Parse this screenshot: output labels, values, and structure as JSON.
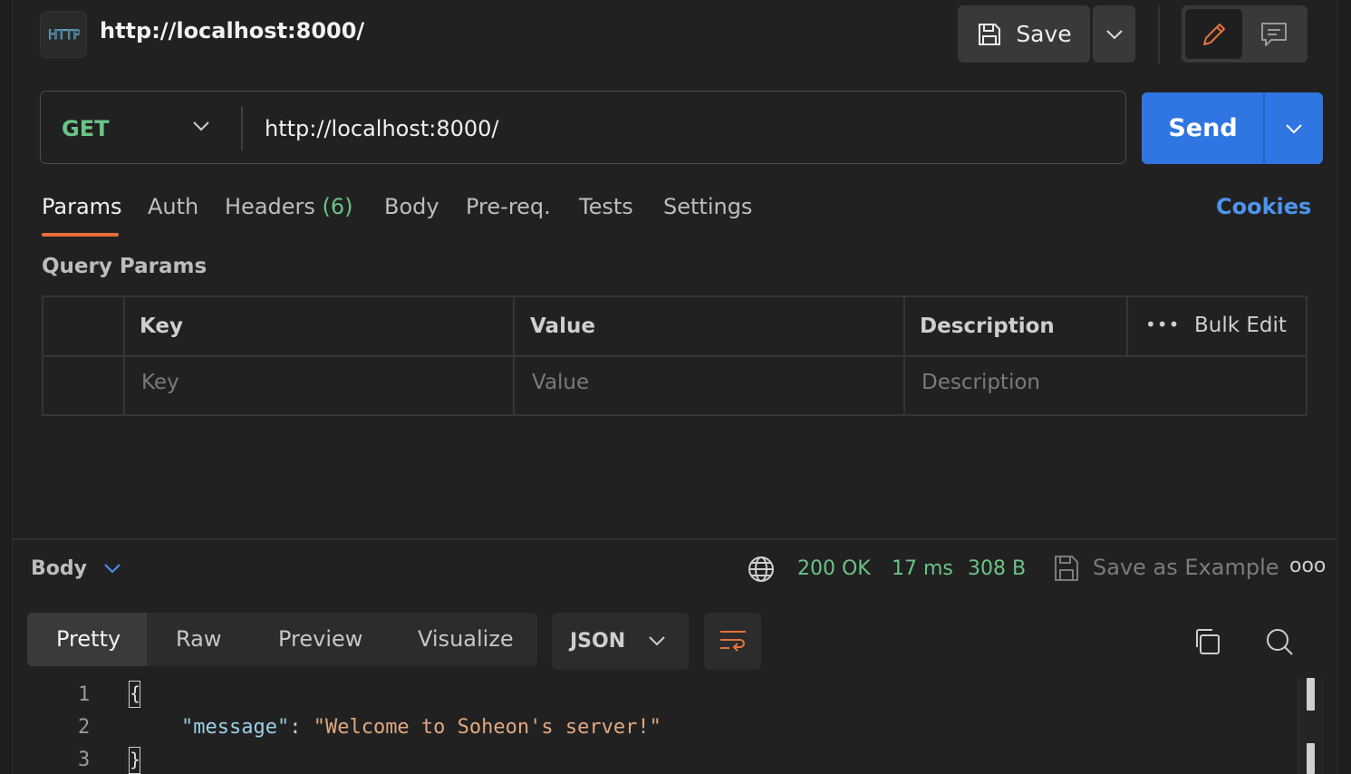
{
  "header": {
    "badge_text": "HTTP",
    "title": "http://localhost:8000/",
    "save_label": "Save"
  },
  "request": {
    "method": "GET",
    "url": "http://localhost:8000/",
    "send_label": "Send"
  },
  "tabs": [
    {
      "label": "Params",
      "active": true
    },
    {
      "label": "Auth"
    },
    {
      "label": "Headers",
      "count": "(6)"
    },
    {
      "label": "Body"
    },
    {
      "label": "Pre-req."
    },
    {
      "label": "Tests"
    },
    {
      "label": "Settings"
    }
  ],
  "cookies_label": "Cookies",
  "query_params": {
    "title": "Query Params",
    "columns": [
      "Key",
      "Value",
      "Description"
    ],
    "bulk_edit": "Bulk Edit",
    "placeholders": [
      "Key",
      "Value",
      "Description"
    ]
  },
  "response": {
    "body_label": "Body",
    "status": "200 OK",
    "time": "17 ms",
    "size": "308 B",
    "save_example": "Save as Example",
    "views": [
      "Pretty",
      "Raw",
      "Preview",
      "Visualize"
    ],
    "active_view": "Pretty",
    "format": "JSON",
    "code_lines": [
      {
        "n": "1",
        "text": "{"
      },
      {
        "n": "2",
        "key": "\"message\"",
        "sep": ": ",
        "value": "\"Welcome to Soheon's server!\""
      },
      {
        "n": "3",
        "text": "}"
      }
    ]
  },
  "colors": {
    "accent_blue": "#2f76e2",
    "method_green": "#6bc487",
    "tab_underline": "#e66e3c",
    "status_green": "#6bc487"
  }
}
